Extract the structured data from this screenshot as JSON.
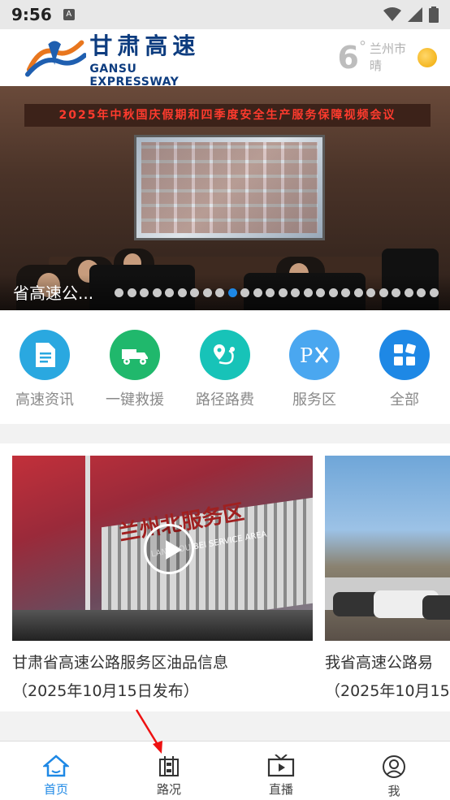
{
  "status_bar": {
    "time": "9:56",
    "notif_badge": "A"
  },
  "header": {
    "logo_cn": "甘肃高速",
    "logo_en": "GANSU EXPRESSWAY",
    "weather": {
      "temperature": "6",
      "degree": "°",
      "city": "兰州市",
      "condition": "晴",
      "icon": "sun-icon"
    }
  },
  "banner": {
    "title": "2025年中秋国庆假期和四季度安全生产服务保障视频会议",
    "caption": "省高速公...",
    "slide_count": 26,
    "active_index": 9
  },
  "quick_links": [
    {
      "label": "高速资讯",
      "icon": "document-icon",
      "color": "#2aa8e0"
    },
    {
      "label": "一键救援",
      "icon": "tow-truck-icon",
      "color": "#20b86c"
    },
    {
      "label": "路径路费",
      "icon": "route-icon",
      "color": "#17c3b8"
    },
    {
      "label": "服务区",
      "icon": "px-service-icon",
      "color": "#4aa7f0"
    },
    {
      "label": "全部",
      "icon": "grid-icon",
      "color": "#1e88e5"
    }
  ],
  "videos": [
    {
      "title": "甘肃省高速公路服务区油品信息",
      "date": "（2025年10月15日发布）",
      "sign_text": "兰州北服务区",
      "sign_en": "LANZHOU BEI SERVICE AREA"
    },
    {
      "title": "我省高速公路易",
      "date": "（2025年10月15"
    }
  ],
  "tabbar": [
    {
      "label": "首页",
      "icon": "home-icon",
      "active": true
    },
    {
      "label": "路况",
      "icon": "road-icon",
      "active": false
    },
    {
      "label": "直播",
      "icon": "tv-icon",
      "active": false
    },
    {
      "label": "我",
      "icon": "user-icon",
      "active": false
    }
  ],
  "colors": {
    "accent": "#1e88e5",
    "brand": "#0d3c7f"
  }
}
